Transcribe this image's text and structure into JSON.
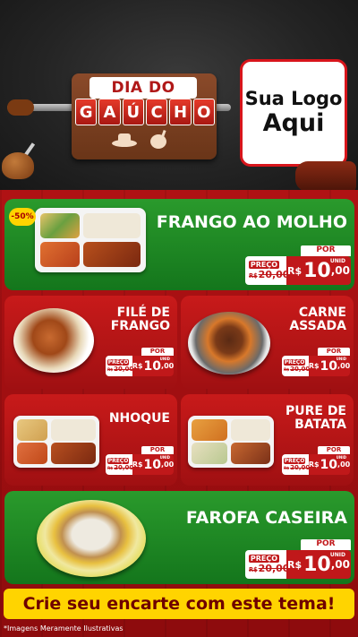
{
  "header": {
    "logo_line1": "DIA DO",
    "logo_letters": [
      "G",
      "A",
      "Ú",
      "C",
      "H",
      "O"
    ],
    "logo_box_line1": "Sua Logo",
    "logo_box_line2": "Aqui"
  },
  "badge": "-50%",
  "products": [
    {
      "name_lines": [
        "FRANGO AO MOLHO"
      ],
      "por": "POR",
      "preco_label": "PREÇO",
      "old_currency": "R$",
      "old_price": "20,00",
      "new_currency": "R$",
      "new_int": "10",
      "new_dec": ",00",
      "unid": "UNID"
    },
    {
      "name_lines": [
        "FILÉ DE",
        "FRANGO"
      ],
      "por": "POR",
      "preco_label": "PREÇO",
      "old_currency": "R$",
      "old_price": "20,00",
      "new_currency": "R$",
      "new_int": "10",
      "new_dec": ",00",
      "unid": "UNID"
    },
    {
      "name_lines": [
        "CARNE",
        "ASSADA"
      ],
      "por": "POR",
      "preco_label": "PREÇO",
      "old_currency": "R$",
      "old_price": "20,00",
      "new_currency": "R$",
      "new_int": "10",
      "new_dec": ",00",
      "unid": "UNID"
    },
    {
      "name_lines": [
        "NHOQUE"
      ],
      "por": "POR",
      "preco_label": "PREÇO",
      "old_currency": "R$",
      "old_price": "20,00",
      "new_currency": "R$",
      "new_int": "10",
      "new_dec": ",00",
      "unid": "UNID"
    },
    {
      "name_lines": [
        "PURE DE",
        "BATATA"
      ],
      "por": "POR",
      "preco_label": "PREÇO",
      "old_currency": "R$",
      "old_price": "20,00",
      "new_currency": "R$",
      "new_int": "10",
      "new_dec": ",00",
      "unid": "UNID"
    },
    {
      "name_lines": [
        "FAROFA CASEIRA"
      ],
      "por": "POR",
      "preco_label": "PREÇO",
      "old_currency": "R$",
      "old_price": "20,00",
      "new_currency": "R$",
      "new_int": "10",
      "new_dec": ",00",
      "unid": "UNID"
    }
  ],
  "cta": "Crie seu encarte com este tema!",
  "footnote": "*Imagens Meramente Ilustrativas",
  "colors": {
    "green": "#1f8a24",
    "red": "#b51416",
    "yellow": "#ffd400",
    "dark_red": "#6e0000"
  }
}
